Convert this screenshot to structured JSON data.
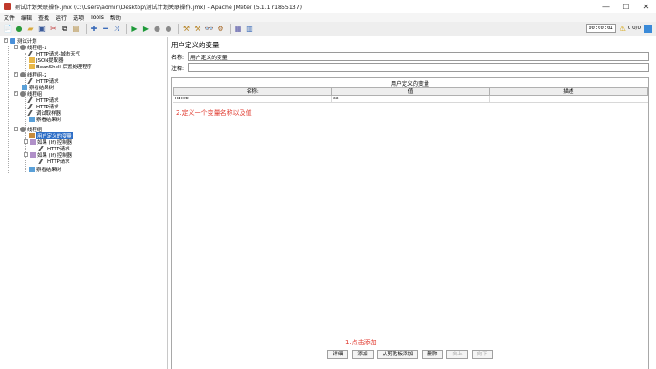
{
  "window": {
    "title": "测试计划关联操作.jmx (C:\\Users\\admin\\Desktop\\测试计划关联操作.jmx) - Apache JMeter (5.1.1 r1855137)",
    "minimize": "—",
    "maximize": "☐",
    "close": "✕"
  },
  "menu": [
    "文件",
    "编辑",
    "查找",
    "运行",
    "选项",
    "Tools",
    "帮助"
  ],
  "toolbar": {
    "timer": "00:00:01",
    "threads": "0 0/0"
  },
  "tree": {
    "plan": "测试计划",
    "tg1": "线程组-1",
    "tg1_http": "HTTP请求-城市天气",
    "tg1_json": "JSON提取器",
    "tg1_bean": "BeanShell 后置处理程序",
    "tg2": "线程组-2",
    "tg2_http": "HTTP请求",
    "tg2_listener": "察看结果树",
    "tg3": "线程组",
    "tg3_http1": "HTTP请求",
    "tg3_http2": "HTTP请求",
    "tg3_debug": "调试取样器",
    "tg3_listener": "察看结果树",
    "tg4": "线程组",
    "tg4_vars": "用户定义的变量",
    "tg4_if1": "如果 (If) 控制器",
    "tg4_if1_http": "HTTP请求",
    "tg4_if2": "如果 (If) 控制器",
    "tg4_if2_http": "HTTP请求",
    "tg4_listener": "察看结果树"
  },
  "panel": {
    "title": "用户定义的变量",
    "name_label": "名称:",
    "name_value": "用户定义的变量",
    "comment_label": "注释:",
    "comment_value": "",
    "table_caption": "用户定义的变量",
    "columns": [
      "名称:",
      "值",
      "描述"
    ],
    "rows": [
      {
        "name": "name",
        "value": "ss",
        "desc": ""
      }
    ],
    "buttons": {
      "detail": "详细",
      "add": "添加",
      "add_clipboard": "从剪贴板添加",
      "delete": "删除",
      "up": "向上",
      "down": "向下"
    }
  },
  "annotations": {
    "step1": "1.点击添加",
    "step2": "2.定义一个变量名称以及值"
  },
  "colors": {
    "annotation": "#e03a2f",
    "selection": "#2f6fc7"
  }
}
